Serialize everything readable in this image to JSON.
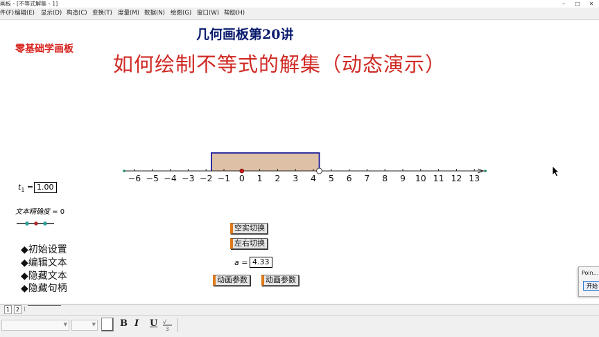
{
  "window": {
    "title": "画板 - [不等式解集 - 1]",
    "minimize": "–",
    "maximize": "□",
    "close": "✕"
  },
  "menu": [
    "件(F)",
    "编辑(E)",
    "显示(D)",
    "构造(C)",
    "变换(T)",
    "度量(M)",
    "数据(N)",
    "绘图(G)",
    "窗口(W)",
    "帮助(H)"
  ],
  "sketch": {
    "brand": "零基础学画板",
    "subtitle": "几何画板第20讲",
    "headline": "如何绘制不等式的解集（动态演示）",
    "t1_label": "t",
    "t1_sub": "1",
    "t1_eq": " = ",
    "t1_value": "1.00",
    "precision_label": "文本精确度",
    "precision_value": " = 0",
    "button_solid_hollow": "空实切换",
    "button_left_right": "左右切换",
    "a_label": "a",
    "a_eq": " = ",
    "a_value": "4.33",
    "button_animate_1": "动画参数",
    "button_animate_2": "动画参数",
    "side_items": [
      "◆初始设置",
      "◆编辑文本",
      "◆隐藏文本",
      "◆隐藏句柄"
    ]
  },
  "number_line": {
    "ticks": [
      -6,
      -5,
      -4,
      -3,
      -2,
      -1,
      0,
      1,
      2,
      3,
      4,
      5,
      6,
      7,
      8,
      9,
      10,
      11,
      12,
      13
    ],
    "tick_labels": [
      "−6",
      "−5",
      "−4",
      "−3",
      "−2",
      "−1",
      "0",
      "1",
      "2",
      "3",
      "4",
      "5",
      "6",
      "7",
      "8",
      "9",
      "10",
      "11",
      "12",
      "13"
    ],
    "range": [
      -6.5,
      13.5
    ],
    "region_start": -1.7,
    "region_end": 4.33,
    "origin_point": 0,
    "endpoint_style": "hollow",
    "colors": {
      "fill": "#ddc0a6",
      "border": "#1a1a9c",
      "axis": "#222222",
      "origin": "#cc1b1b",
      "ends": "#1a8a5a"
    }
  },
  "tabs": [
    "1",
    "2"
  ],
  "format_toolbar": {
    "bold": "B",
    "italic": "I",
    "underline": "U"
  },
  "popup": {
    "title": "Poin...",
    "button": "开始"
  }
}
